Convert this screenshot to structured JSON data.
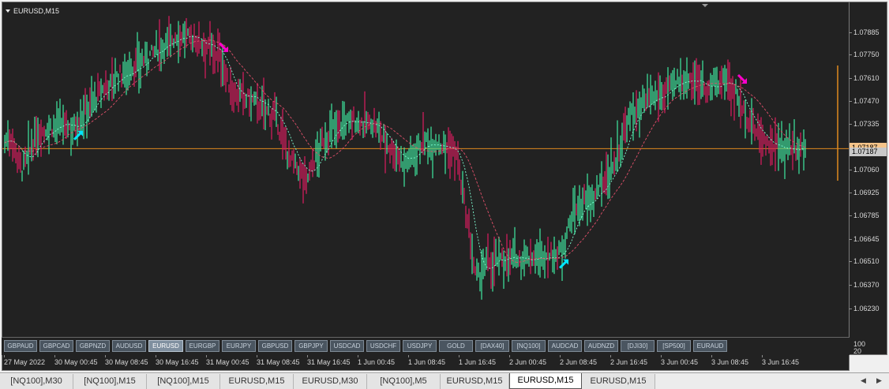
{
  "window": {
    "symbol_title": "EURUSD,M15",
    "current_price": "1.07187",
    "current_price_2": "1.07187"
  },
  "colors": {
    "background": "#222222",
    "bull": "#3ddc97",
    "bear": "#d01c5c",
    "ma_fast": "#7fffd4",
    "ma_slow": "#e0506a",
    "price_line": "#e08a1e",
    "arrow_buy": "#00e5ff",
    "arrow_sell": "#ff00cc"
  },
  "price_axis": {
    "ticks": [
      "1.07885",
      "1.07750",
      "1.07610",
      "1.07470",
      "1.07335",
      "1.07060",
      "1.06925",
      "1.06785",
      "1.06645",
      "1.06510",
      "1.06370",
      "1.06230"
    ],
    "oscillator_labels": [
      "100",
      "20"
    ]
  },
  "time_axis": {
    "labels": [
      "27 May 2022",
      "30 May 00:45",
      "30 May 08:45",
      "30 May 16:45",
      "31 May 00:45",
      "31 May 08:45",
      "31 May 16:45",
      "1 Jun 00:45",
      "1 Jun 08:45",
      "1 Jun 16:45",
      "2 Jun 00:45",
      "2 Jun 08:45",
      "2 Jun 16:45",
      "3 Jun 00:45",
      "3 Jun 08:45",
      "3 Jun 16:45"
    ]
  },
  "symbol_buttons": [
    {
      "label": "GBPAUD",
      "active": false
    },
    {
      "label": "GBPCAD",
      "active": false
    },
    {
      "label": "GBPNZD",
      "active": false
    },
    {
      "label": "AUDUSD",
      "active": false
    },
    {
      "label": "EURUSD",
      "active": true
    },
    {
      "label": "EURGBP",
      "active": false
    },
    {
      "label": "EURJPY",
      "active": false
    },
    {
      "label": "GBPUSD",
      "active": false
    },
    {
      "label": "GBPJPY",
      "active": false
    },
    {
      "label": "USDCAD",
      "active": false
    },
    {
      "label": "USDCHF",
      "active": false
    },
    {
      "label": "USDJPY",
      "active": false
    },
    {
      "label": "GOLD",
      "active": false
    },
    {
      "label": "[DAX40]",
      "active": false
    },
    {
      "label": "[NQ100]",
      "active": false
    },
    {
      "label": "AUDCAD",
      "active": false
    },
    {
      "label": "AUDNZD",
      "active": false
    },
    {
      "label": "[DJI30]",
      "active": false
    },
    {
      "label": "[SP500]",
      "active": false
    },
    {
      "label": "EURAUD",
      "active": false
    }
  ],
  "tabs": [
    {
      "label": "[NQ100],M30",
      "active": false
    },
    {
      "label": "[NQ100],M15",
      "active": false
    },
    {
      "label": "[NQ100],M15",
      "active": false
    },
    {
      "label": "EURUSD,M15",
      "active": false
    },
    {
      "label": "EURUSD,M30",
      "active": false
    },
    {
      "label": "[NQ100],M5",
      "active": false
    },
    {
      "label": "EURUSD,M15",
      "active": false
    },
    {
      "label": "EURUSD,M15",
      "active": true
    },
    {
      "label": "EURUSD,M15",
      "active": false
    }
  ],
  "chart_data": {
    "type": "bar",
    "ylim": [
      1.062,
      1.0795
    ],
    "current_price": 1.07187,
    "price_path": [
      [
        0,
        1.072
      ],
      [
        10,
        1.0727
      ],
      [
        25,
        1.0706
      ],
      [
        45,
        1.0728
      ],
      [
        70,
        1.0733
      ],
      [
        90,
        1.0731
      ],
      [
        110,
        1.0745
      ],
      [
        140,
        1.076
      ],
      [
        175,
        1.077
      ],
      [
        200,
        1.078
      ],
      [
        225,
        1.0787
      ],
      [
        250,
        1.0783
      ],
      [
        275,
        1.0775
      ],
      [
        290,
        1.0752
      ],
      [
        315,
        1.0748
      ],
      [
        345,
        1.0738
      ],
      [
        365,
        1.0712
      ],
      [
        385,
        1.07
      ],
      [
        405,
        1.0722
      ],
      [
        425,
        1.0734
      ],
      [
        450,
        1.0735
      ],
      [
        470,
        1.0733
      ],
      [
        490,
        1.072
      ],
      [
        510,
        1.071
      ],
      [
        530,
        1.0722
      ],
      [
        555,
        1.0722
      ],
      [
        575,
        1.0715
      ],
      [
        590,
        1.067
      ],
      [
        600,
        1.064
      ],
      [
        615,
        1.065
      ],
      [
        640,
        1.0653
      ],
      [
        665,
        1.0653
      ],
      [
        705,
        1.0655
      ],
      [
        725,
        1.0682
      ],
      [
        750,
        1.069
      ],
      [
        775,
        1.071
      ],
      [
        795,
        1.0738
      ],
      [
        820,
        1.0747
      ],
      [
        850,
        1.0756
      ],
      [
        870,
        1.0762
      ],
      [
        895,
        1.0755
      ],
      [
        920,
        1.076
      ],
      [
        940,
        1.074
      ],
      [
        960,
        1.0725
      ],
      [
        985,
        1.0718
      ],
      [
        1000,
        1.072
      ],
      [
        1020,
        1.0719
      ]
    ],
    "signals": [
      {
        "type": "buy",
        "x": 97,
        "price": 1.0727
      },
      {
        "type": "sell",
        "x": 281,
        "price": 1.0779
      },
      {
        "type": "buy",
        "x": 712,
        "price": 1.065
      },
      {
        "type": "sell",
        "x": 938,
        "price": 1.076
      }
    ]
  }
}
